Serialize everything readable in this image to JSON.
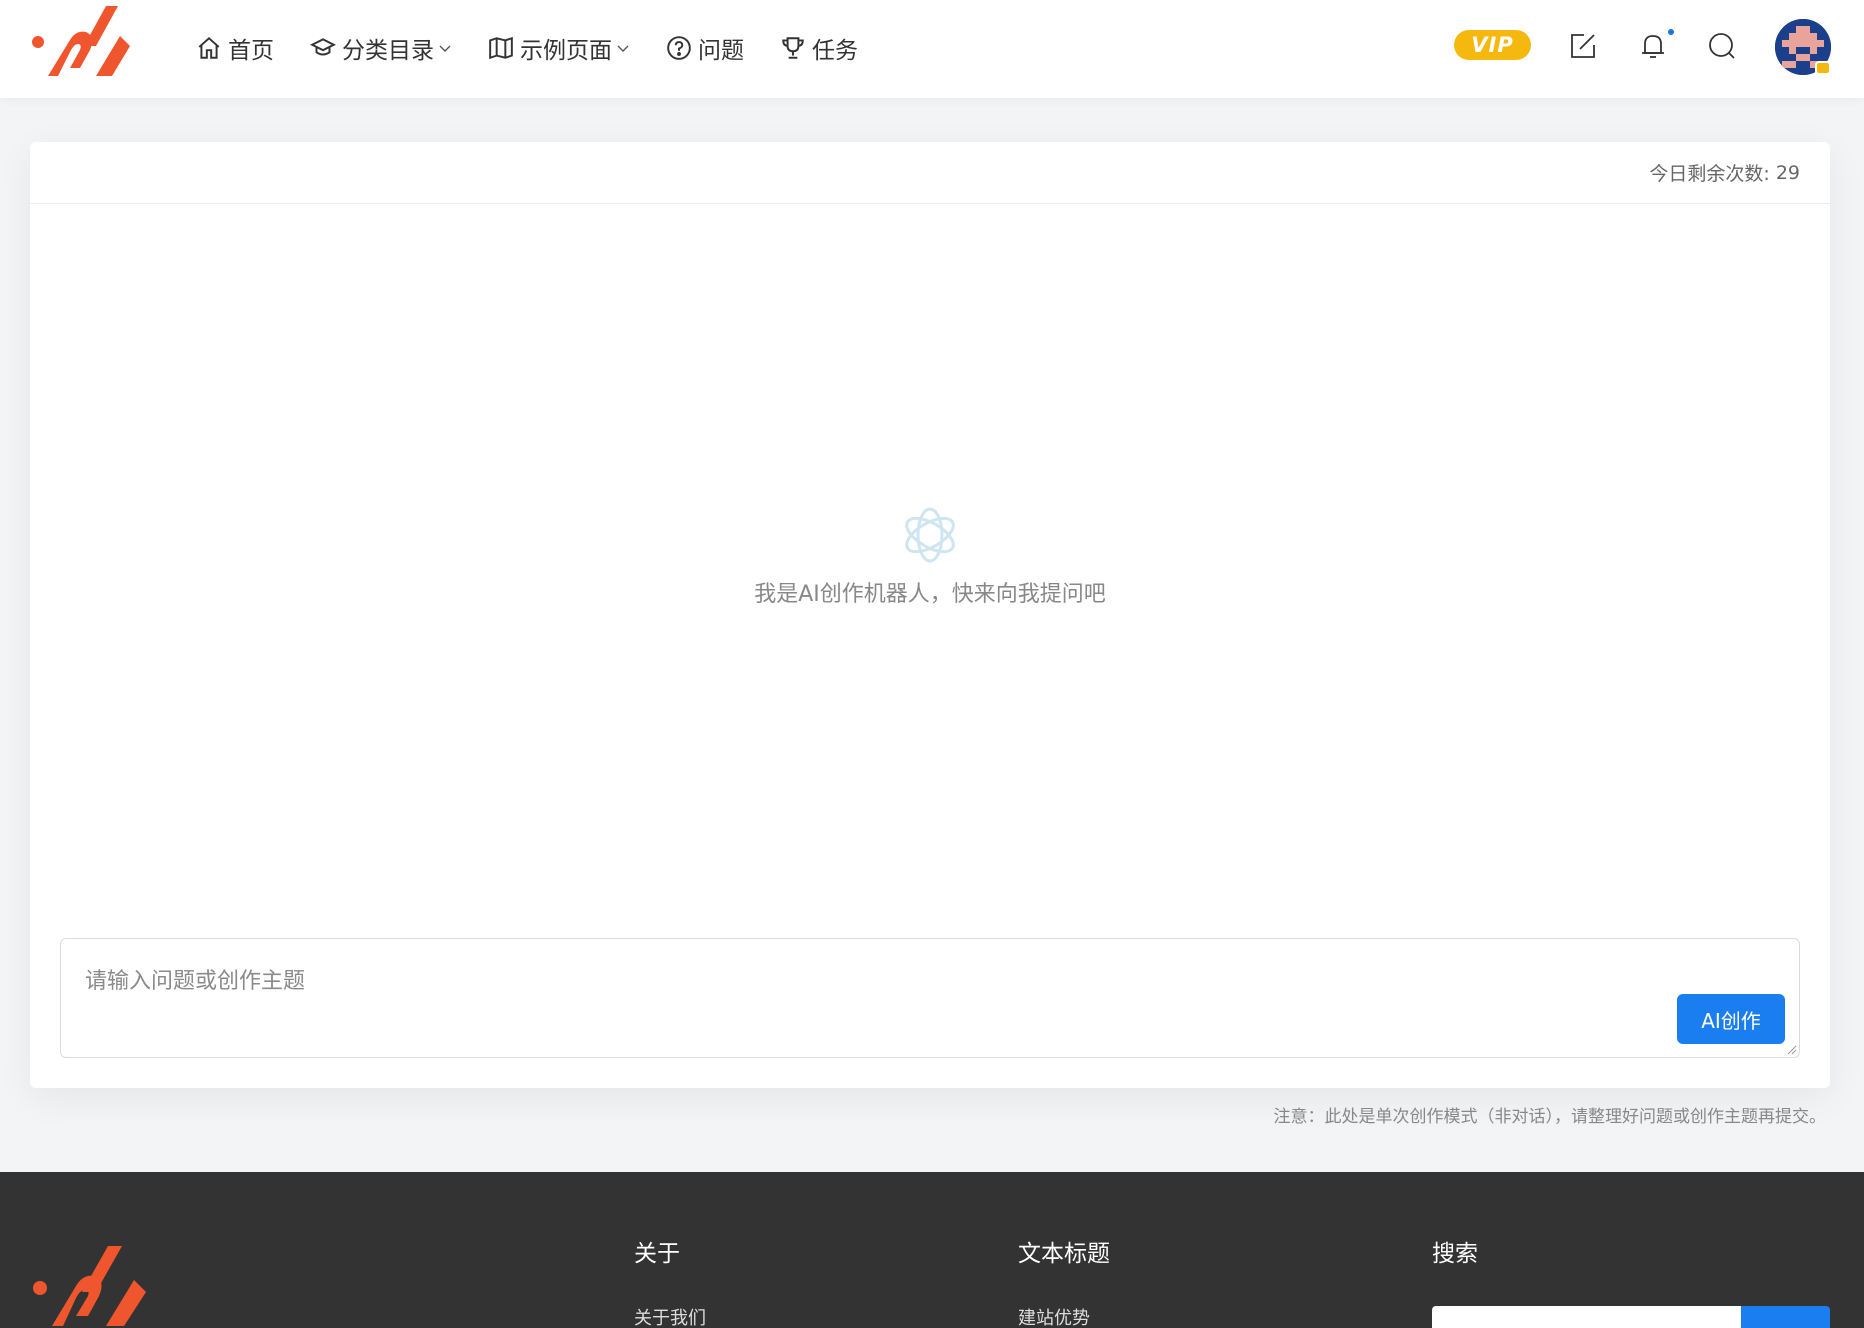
{
  "header": {
    "nav": [
      {
        "label": "首页",
        "icon": "home-icon",
        "dropdown": false
      },
      {
        "label": "分类目录",
        "icon": "graduation-cap-icon",
        "dropdown": true
      },
      {
        "label": "示例页面",
        "icon": "map-icon",
        "dropdown": true
      },
      {
        "label": "问题",
        "icon": "question-circle-icon",
        "dropdown": false
      },
      {
        "label": "任务",
        "icon": "trophy-icon",
        "dropdown": false
      }
    ],
    "vip_label": "VIP",
    "icons": [
      "edit-icon",
      "bell-icon",
      "search-icon",
      "avatar"
    ],
    "notification_dot_color": "#1a73e8"
  },
  "card": {
    "remaining_label": "今日剩余次数:",
    "remaining_count": "29",
    "empty_text": "我是AI创作机器人，快来向我提问吧",
    "input_placeholder": "请输入问题或创作主题",
    "submit_label": "AI创作"
  },
  "note": "注意：此处是单次创作模式（非对话），请整理好问题或创作主题再提交。",
  "footer": {
    "columns": [
      {
        "title": "关于",
        "link": "关于我们"
      },
      {
        "title": "文本标题",
        "link": "建站优势"
      },
      {
        "title": "搜索"
      }
    ]
  },
  "colors": {
    "brand_orange": "#f0562e",
    "accent_blue": "#1a7df0",
    "vip_yellow": "#f5b80e",
    "footer_bg": "#333333",
    "page_bg": "#f3f4f6"
  }
}
